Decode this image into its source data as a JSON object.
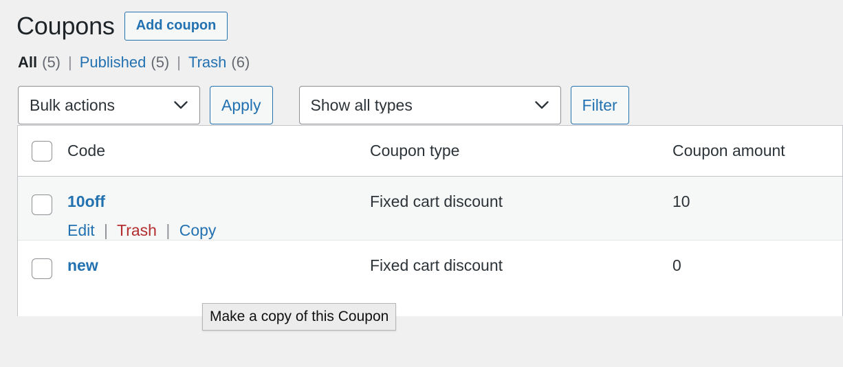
{
  "header": {
    "title": "Coupons",
    "add_button_label": "Add coupon"
  },
  "status_filters": [
    {
      "label": "All",
      "count": "(5)",
      "current": true
    },
    {
      "label": "Published",
      "count": "(5)",
      "current": false
    },
    {
      "label": "Trash",
      "count": "(6)",
      "current": false
    }
  ],
  "separator": "|",
  "tablenav": {
    "bulk_actions_value": "Bulk actions",
    "apply_label": "Apply",
    "type_filter_value": "Show all types",
    "filter_label": "Filter"
  },
  "table": {
    "columns": {
      "code": "Code",
      "type": "Coupon type",
      "amount": "Coupon amount"
    },
    "rows": [
      {
        "code": "10off",
        "type": "Fixed cart discount",
        "amount": "10",
        "actions": {
          "edit": "Edit",
          "trash": "Trash",
          "copy": "Copy"
        }
      },
      {
        "code": "new",
        "type": "Fixed cart discount",
        "amount": "0"
      }
    ]
  },
  "tooltip": {
    "text": "Make a copy of this Coupon"
  },
  "colors": {
    "link": "#2271b1",
    "trash": "#b32d2e",
    "text": "#2c3338",
    "muted": "#646970",
    "page_bg": "#f0f0f1",
    "row_alt_bg": "#f6f7f7"
  }
}
